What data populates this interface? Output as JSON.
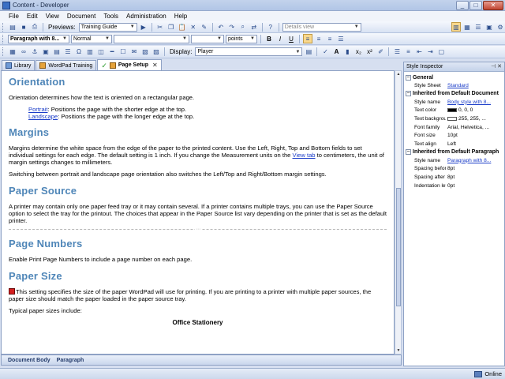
{
  "window": {
    "title": "Content - Developer",
    "buttons": {
      "minimize": "_",
      "maximize": "□",
      "close": "✕"
    }
  },
  "menu": [
    "File",
    "Edit",
    "View",
    "Document",
    "Tools",
    "Administration",
    "Help"
  ],
  "toolbar1": {
    "preview_label": "Previews:",
    "preview_value": "Training Guide",
    "view_value": "Details view"
  },
  "toolbar2": {
    "paragraph_style": "Paragraph with 8...",
    "char_style": "Normal",
    "font": "",
    "size": "",
    "units": "points"
  },
  "toolbar3": {
    "display_label": "Display:",
    "display_value": "Player"
  },
  "tabs": [
    {
      "label": "Library",
      "active": false
    },
    {
      "label": "WordPad Training",
      "active": false
    },
    {
      "label": "Page Setup",
      "active": true
    }
  ],
  "document": {
    "orientation_heading": "Orientation",
    "orientation_text": "Orientation determines how the text is oriented on a rectangular page.",
    "portrait_link": "Portrait",
    "portrait_text": ": Positions the page with the shorter edge at the top.",
    "landscape_link": "Landscape",
    "landscape_text": ": Positions the page with the longer edge at the top.",
    "margins_heading": "Margins",
    "margins_text_1": "Margins determine the white space from the edge of the paper to the printed content. Use the Left, Right, Top and Bottom fields to set individual settings for each edge. The default setting is 1 inch. If you change the Measurement units on the ",
    "view_tab_link": "View tab",
    "margins_text_2": " to centimeters, the unit of margin settings changes to millimeters.",
    "margins_text_3": "Switching between portrait and landscape page orientation also switches the Left/Top and Right/Bottom margin settings.",
    "paper_source_heading": "Paper Source",
    "paper_source_text": "A printer may contain only one paper feed tray or it may contain several. If a printer contains multiple trays, you can use the Paper Source option to select the tray for the printout. The choices that appear in the Paper Source list vary depending on the printer that is set as the default printer.",
    "page_numbers_heading": "Page Numbers",
    "page_numbers_text": "Enable Print Page Numbers to include a page number on each page.",
    "paper_size_heading": "Paper Size",
    "paper_size_text": "This setting specifies the size of the paper WordPad will use for printing. If you are printing to a printer with multiple paper sources, the paper size should match the paper loaded in the paper source tray.",
    "typical_sizes_text": "Typical paper sizes include:",
    "office_stationery": "Office Stationery"
  },
  "breadcrumb": [
    "Document Body",
    "Paragraph"
  ],
  "inspector": {
    "title": "Style Inspector",
    "groups": [
      {
        "name": "General",
        "rows": [
          {
            "name": "Style Sheet",
            "value": "Standard",
            "link": true
          }
        ]
      },
      {
        "name": "Inherited from Default Document",
        "rows": [
          {
            "name": "Style name",
            "value": "Body style with 8...",
            "link": true
          },
          {
            "name": "Text color",
            "value": "0, 0, 0",
            "swatch": "#000000"
          },
          {
            "name": "Text background",
            "value": "255, 255, ...",
            "swatch": "#ffffff"
          },
          {
            "name": "Font family",
            "value": "Arial, Helvetica, ..."
          },
          {
            "name": "Font size",
            "value": "10pt"
          },
          {
            "name": "Text align",
            "value": "Left"
          }
        ]
      },
      {
        "name": "Inherited from Default Paragraph",
        "rows": [
          {
            "name": "Style name",
            "value": "Paragraph with 8...",
            "link": true
          },
          {
            "name": "Spacing before",
            "value": "8pt"
          },
          {
            "name": "Spacing after",
            "value": "8pt"
          },
          {
            "name": "Indentation left",
            "value": "0pt"
          }
        ]
      }
    ]
  },
  "status": {
    "text": "Online"
  }
}
